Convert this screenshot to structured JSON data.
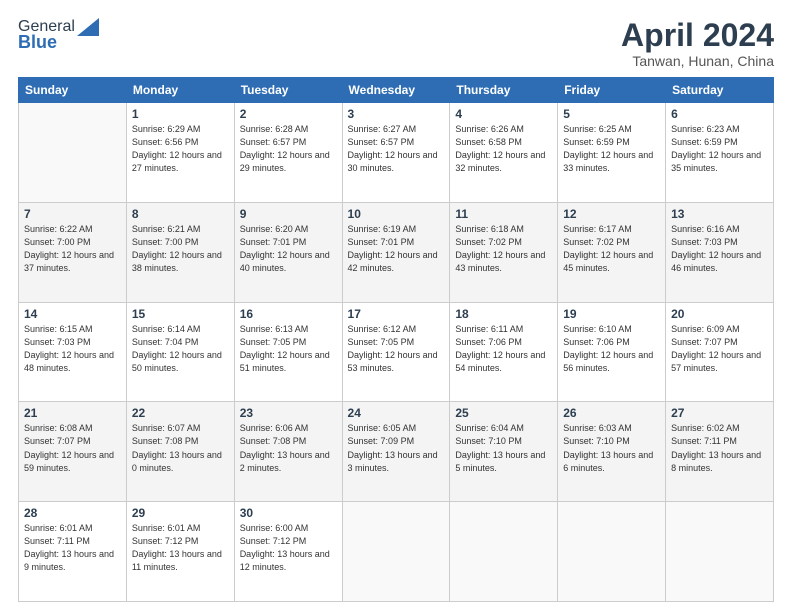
{
  "header": {
    "logo_general": "General",
    "logo_blue": "Blue",
    "month_title": "April 2024",
    "location": "Tanwan, Hunan, China"
  },
  "days_of_week": [
    "Sunday",
    "Monday",
    "Tuesday",
    "Wednesday",
    "Thursday",
    "Friday",
    "Saturday"
  ],
  "weeks": [
    [
      {
        "day": "",
        "sunrise": "",
        "sunset": "",
        "daylight": ""
      },
      {
        "day": "1",
        "sunrise": "Sunrise: 6:29 AM",
        "sunset": "Sunset: 6:56 PM",
        "daylight": "Daylight: 12 hours and 27 minutes."
      },
      {
        "day": "2",
        "sunrise": "Sunrise: 6:28 AM",
        "sunset": "Sunset: 6:57 PM",
        "daylight": "Daylight: 12 hours and 29 minutes."
      },
      {
        "day": "3",
        "sunrise": "Sunrise: 6:27 AM",
        "sunset": "Sunset: 6:57 PM",
        "daylight": "Daylight: 12 hours and 30 minutes."
      },
      {
        "day": "4",
        "sunrise": "Sunrise: 6:26 AM",
        "sunset": "Sunset: 6:58 PM",
        "daylight": "Daylight: 12 hours and 32 minutes."
      },
      {
        "day": "5",
        "sunrise": "Sunrise: 6:25 AM",
        "sunset": "Sunset: 6:59 PM",
        "daylight": "Daylight: 12 hours and 33 minutes."
      },
      {
        "day": "6",
        "sunrise": "Sunrise: 6:23 AM",
        "sunset": "Sunset: 6:59 PM",
        "daylight": "Daylight: 12 hours and 35 minutes."
      }
    ],
    [
      {
        "day": "7",
        "sunrise": "Sunrise: 6:22 AM",
        "sunset": "Sunset: 7:00 PM",
        "daylight": "Daylight: 12 hours and 37 minutes."
      },
      {
        "day": "8",
        "sunrise": "Sunrise: 6:21 AM",
        "sunset": "Sunset: 7:00 PM",
        "daylight": "Daylight: 12 hours and 38 minutes."
      },
      {
        "day": "9",
        "sunrise": "Sunrise: 6:20 AM",
        "sunset": "Sunset: 7:01 PM",
        "daylight": "Daylight: 12 hours and 40 minutes."
      },
      {
        "day": "10",
        "sunrise": "Sunrise: 6:19 AM",
        "sunset": "Sunset: 7:01 PM",
        "daylight": "Daylight: 12 hours and 42 minutes."
      },
      {
        "day": "11",
        "sunrise": "Sunrise: 6:18 AM",
        "sunset": "Sunset: 7:02 PM",
        "daylight": "Daylight: 12 hours and 43 minutes."
      },
      {
        "day": "12",
        "sunrise": "Sunrise: 6:17 AM",
        "sunset": "Sunset: 7:02 PM",
        "daylight": "Daylight: 12 hours and 45 minutes."
      },
      {
        "day": "13",
        "sunrise": "Sunrise: 6:16 AM",
        "sunset": "Sunset: 7:03 PM",
        "daylight": "Daylight: 12 hours and 46 minutes."
      }
    ],
    [
      {
        "day": "14",
        "sunrise": "Sunrise: 6:15 AM",
        "sunset": "Sunset: 7:03 PM",
        "daylight": "Daylight: 12 hours and 48 minutes."
      },
      {
        "day": "15",
        "sunrise": "Sunrise: 6:14 AM",
        "sunset": "Sunset: 7:04 PM",
        "daylight": "Daylight: 12 hours and 50 minutes."
      },
      {
        "day": "16",
        "sunrise": "Sunrise: 6:13 AM",
        "sunset": "Sunset: 7:05 PM",
        "daylight": "Daylight: 12 hours and 51 minutes."
      },
      {
        "day": "17",
        "sunrise": "Sunrise: 6:12 AM",
        "sunset": "Sunset: 7:05 PM",
        "daylight": "Daylight: 12 hours and 53 minutes."
      },
      {
        "day": "18",
        "sunrise": "Sunrise: 6:11 AM",
        "sunset": "Sunset: 7:06 PM",
        "daylight": "Daylight: 12 hours and 54 minutes."
      },
      {
        "day": "19",
        "sunrise": "Sunrise: 6:10 AM",
        "sunset": "Sunset: 7:06 PM",
        "daylight": "Daylight: 12 hours and 56 minutes."
      },
      {
        "day": "20",
        "sunrise": "Sunrise: 6:09 AM",
        "sunset": "Sunset: 7:07 PM",
        "daylight": "Daylight: 12 hours and 57 minutes."
      }
    ],
    [
      {
        "day": "21",
        "sunrise": "Sunrise: 6:08 AM",
        "sunset": "Sunset: 7:07 PM",
        "daylight": "Daylight: 12 hours and 59 minutes."
      },
      {
        "day": "22",
        "sunrise": "Sunrise: 6:07 AM",
        "sunset": "Sunset: 7:08 PM",
        "daylight": "Daylight: 13 hours and 0 minutes."
      },
      {
        "day": "23",
        "sunrise": "Sunrise: 6:06 AM",
        "sunset": "Sunset: 7:08 PM",
        "daylight": "Daylight: 13 hours and 2 minutes."
      },
      {
        "day": "24",
        "sunrise": "Sunrise: 6:05 AM",
        "sunset": "Sunset: 7:09 PM",
        "daylight": "Daylight: 13 hours and 3 minutes."
      },
      {
        "day": "25",
        "sunrise": "Sunrise: 6:04 AM",
        "sunset": "Sunset: 7:10 PM",
        "daylight": "Daylight: 13 hours and 5 minutes."
      },
      {
        "day": "26",
        "sunrise": "Sunrise: 6:03 AM",
        "sunset": "Sunset: 7:10 PM",
        "daylight": "Daylight: 13 hours and 6 minutes."
      },
      {
        "day": "27",
        "sunrise": "Sunrise: 6:02 AM",
        "sunset": "Sunset: 7:11 PM",
        "daylight": "Daylight: 13 hours and 8 minutes."
      }
    ],
    [
      {
        "day": "28",
        "sunrise": "Sunrise: 6:01 AM",
        "sunset": "Sunset: 7:11 PM",
        "daylight": "Daylight: 13 hours and 9 minutes."
      },
      {
        "day": "29",
        "sunrise": "Sunrise: 6:01 AM",
        "sunset": "Sunset: 7:12 PM",
        "daylight": "Daylight: 13 hours and 11 minutes."
      },
      {
        "day": "30",
        "sunrise": "Sunrise: 6:00 AM",
        "sunset": "Sunset: 7:12 PM",
        "daylight": "Daylight: 13 hours and 12 minutes."
      },
      {
        "day": "",
        "sunrise": "",
        "sunset": "",
        "daylight": ""
      },
      {
        "day": "",
        "sunrise": "",
        "sunset": "",
        "daylight": ""
      },
      {
        "day": "",
        "sunrise": "",
        "sunset": "",
        "daylight": ""
      },
      {
        "day": "",
        "sunrise": "",
        "sunset": "",
        "daylight": ""
      }
    ]
  ]
}
